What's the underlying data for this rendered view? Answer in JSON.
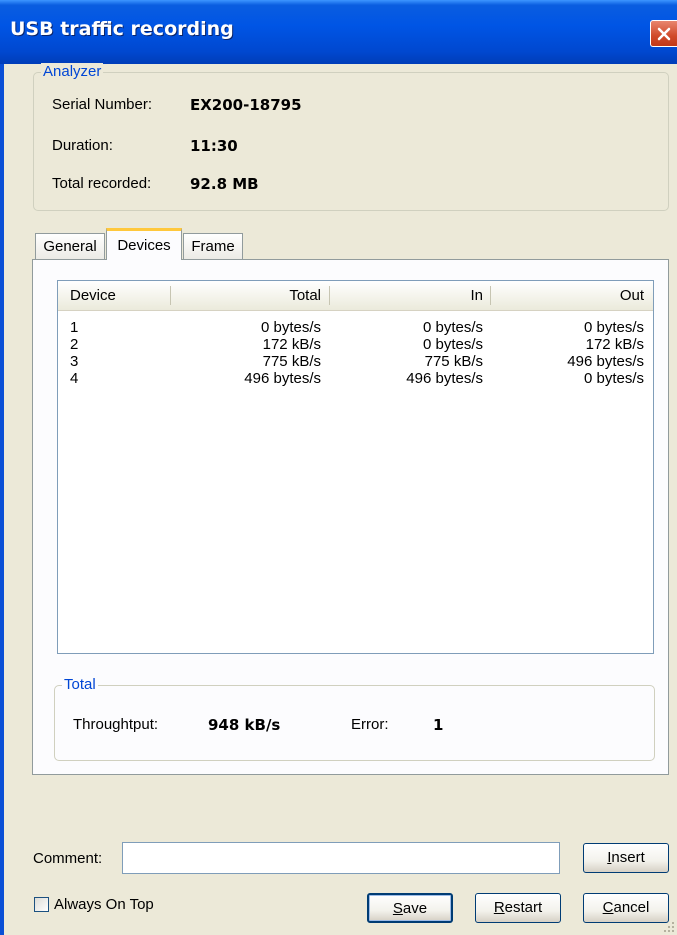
{
  "window": {
    "title": "USB traffic recording"
  },
  "analyzer": {
    "legend": "Analyzer",
    "serial_label": "Serial Number:",
    "serial_value": "EX200-18795",
    "duration_label": "Duration:",
    "duration_value": "11:30",
    "total_label": "Total recorded:",
    "total_value": "92.8 MB"
  },
  "tabs": [
    {
      "label": "General",
      "active": false
    },
    {
      "label": "Devices",
      "active": true
    },
    {
      "label": "Frame",
      "active": false
    }
  ],
  "devices_table": {
    "columns": [
      "Device",
      "Total",
      "In",
      "Out"
    ],
    "rows": [
      [
        "1",
        "0 bytes/s",
        "0 bytes/s",
        "0 bytes/s"
      ],
      [
        "2",
        "172 kB/s",
        "0 bytes/s",
        "172 kB/s"
      ],
      [
        "3",
        "775 kB/s",
        "775 kB/s",
        "496 bytes/s"
      ],
      [
        "4",
        "496 bytes/s",
        "496 bytes/s",
        "0 bytes/s"
      ]
    ]
  },
  "totals": {
    "legend": "Total",
    "throughput_label": "Throughtput:",
    "throughput_value": "948 kB/s",
    "error_label": "Error:",
    "error_value": "1"
  },
  "comment": {
    "label": "Comment:",
    "value": ""
  },
  "buttons": {
    "insert": "nsert",
    "insert_key": "I",
    "save": "ave",
    "save_key": "S",
    "restart": "estart",
    "restart_key": "R",
    "cancel": "ancel",
    "cancel_key": "C"
  },
  "always_on_top": {
    "label": "Always On Top",
    "checked": false
  },
  "colors": {
    "title_bar": "#0055E5",
    "legend_text": "#0046D5",
    "active_tab_accent": "#FFC83C",
    "dialog_bg": "#ECE9D8"
  },
  "icons": {
    "close": "close-icon"
  }
}
